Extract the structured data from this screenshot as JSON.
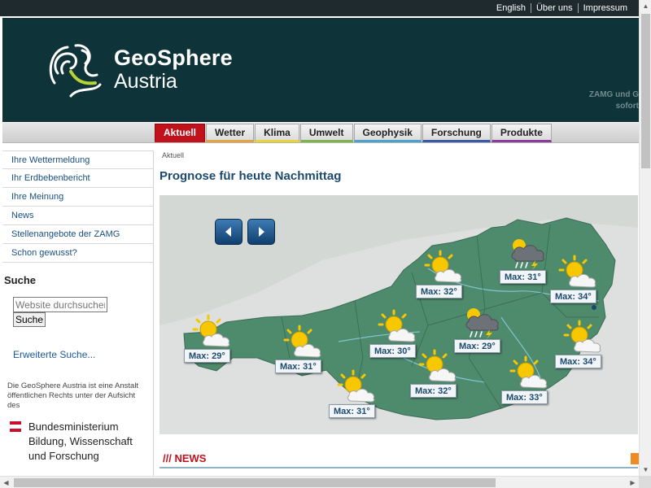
{
  "topbar": {
    "links": [
      "English",
      "Über uns",
      "Impressum"
    ]
  },
  "header": {
    "brand_line1": "GeoSphere",
    "brand_line2": "Austria",
    "promo_line1": "ZAMG und G",
    "promo_line2": "sofort"
  },
  "nav": {
    "tabs": [
      {
        "label": "Aktuell",
        "color": "#c1121b",
        "active": true
      },
      {
        "label": "Wetter",
        "color": "#e6a23c"
      },
      {
        "label": "Klima",
        "color": "#e8d434"
      },
      {
        "label": "Umwelt",
        "color": "#7ab648"
      },
      {
        "label": "Geophysik",
        "color": "#4aa3c8"
      },
      {
        "label": "Forschung",
        "color": "#3b5aa8"
      },
      {
        "label": "Produkte",
        "color": "#8a3d9a"
      }
    ]
  },
  "sidebar": {
    "items": [
      {
        "label": "Ihre Wettermeldung"
      },
      {
        "label": "Ihr Erdbebenbericht"
      },
      {
        "label": "Ihre Meinung"
      },
      {
        "label": "News"
      },
      {
        "label": "Stellenangebote der ZAMG"
      },
      {
        "label": "Schon gewusst?"
      }
    ],
    "search_title": "Suche",
    "search_placeholder": "Website durchsuchen",
    "search_button": "Suche",
    "advanced_search": "Erweiterte Suche...",
    "info_text": "Die GeoSphere Austria ist eine Anstalt öffentlichen Rechts unter der Aufsicht des",
    "ministry_line1": "Bundesministerium",
    "ministry_line2": "Bildung, Wissenschaft",
    "ministry_line3": "und Forschung"
  },
  "main": {
    "breadcrumb": "Aktuell",
    "title": "Prognose für heute Nachmittag",
    "news_heading": "/// NEWS"
  },
  "forecast": [
    {
      "label": "Max: 29°",
      "icon": "sun-cloud-icon"
    },
    {
      "label": "Max: 31°",
      "icon": "sun-cloud-icon"
    },
    {
      "label": "Max: 31°",
      "icon": "sun-cloud-icon"
    },
    {
      "label": "Max: 30°",
      "icon": "sun-cloud-icon"
    },
    {
      "label": "Max: 32°",
      "icon": "sun-cloud-icon"
    },
    {
      "label": "Max: 32°",
      "icon": "sun-cloud-icon"
    },
    {
      "label": "Max: 29°",
      "icon": "thunderstorm-icon"
    },
    {
      "label": "Max: 31°",
      "icon": "thunderstorm-icon"
    },
    {
      "label": "Max: 34°",
      "icon": "sun-cloud-icon"
    },
    {
      "label": "Max: 34°",
      "icon": "sun-cloud-icon"
    },
    {
      "label": "Max: 33°",
      "icon": "sun-cloud-icon"
    }
  ],
  "colors": {
    "header_bg": "#0e3338",
    "map_land": "#4e8a6c",
    "title_blue": "#1c4a6e",
    "accent_red": "#c1121b"
  }
}
